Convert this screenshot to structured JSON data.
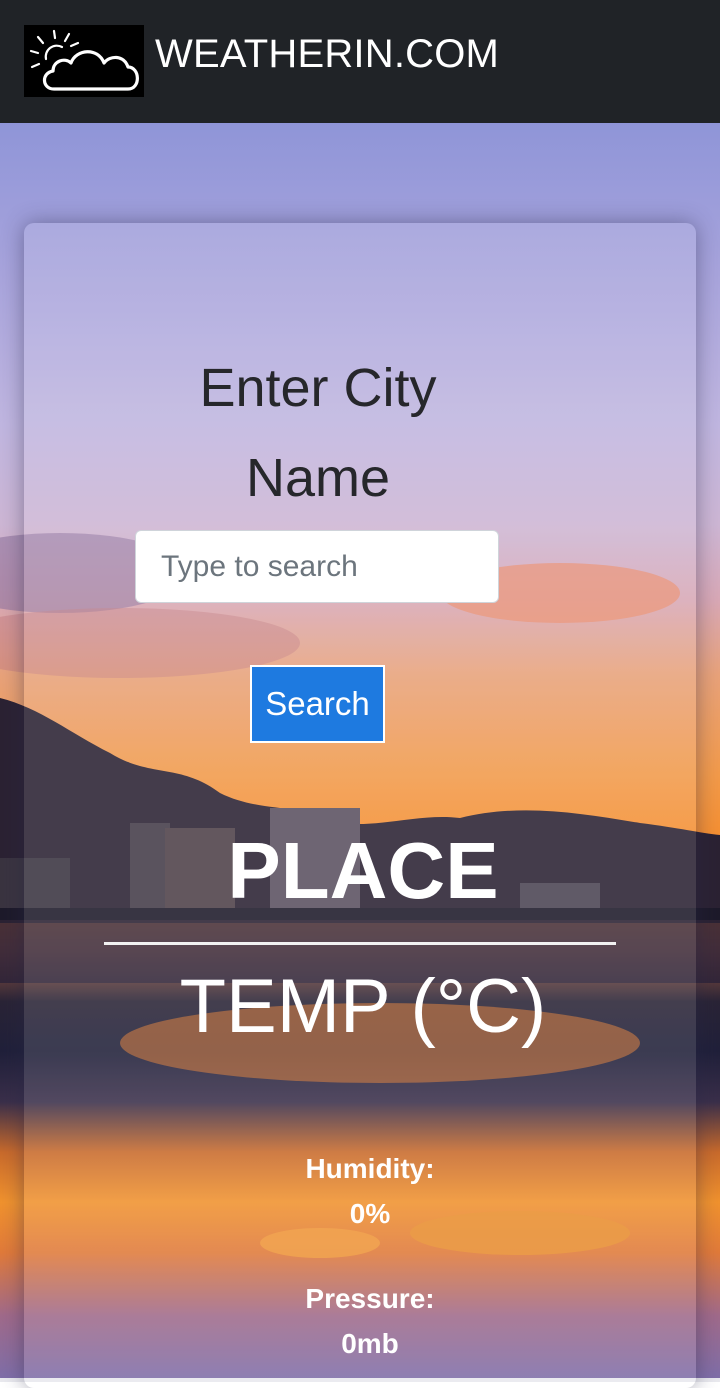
{
  "header": {
    "logo_icon": "sun-cloud-icon",
    "brand": "WEATHERIN.COM"
  },
  "form": {
    "title_line1": "Enter City",
    "title_line2": "Name",
    "search_placeholder": "Type to search",
    "search_button": "Search"
  },
  "result": {
    "place": "PLACE",
    "temp": "TEMP (°C)",
    "humidity_label": "Humidity:",
    "humidity_value": "0%",
    "pressure_label": "Pressure:",
    "pressure_value": "0mb"
  },
  "colors": {
    "header_bg": "#202327",
    "button_bg": "#1e7ae0"
  }
}
